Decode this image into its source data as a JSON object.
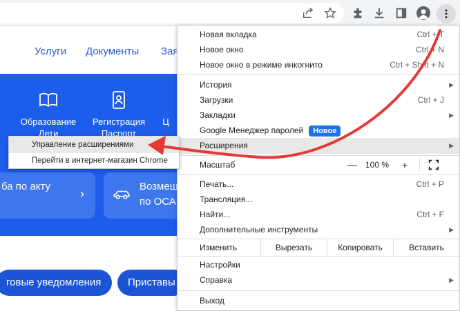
{
  "toolbar": {
    "icons": [
      "share-icon",
      "star-icon",
      "extensions-icon",
      "download-icon",
      "side-panel-icon",
      "profile-icon",
      "more-icon"
    ]
  },
  "site": {
    "nav": [
      "Услуги",
      "Документы",
      "Зая"
    ],
    "services": [
      {
        "icon": "book-icon",
        "label": "Образование Дети"
      },
      {
        "icon": "badge-icon",
        "label": "Регистрация Паспорт"
      },
      {
        "icon": "",
        "label": "Ц"
      }
    ],
    "card_left": "ба по акту",
    "card_right": "Возмещ по ОСА",
    "pill_left": "говые уведомления",
    "pill_right": "Приставы"
  },
  "menu": {
    "items": [
      {
        "label": "Новая вкладка",
        "shortcut": "Ctrl + T"
      },
      {
        "label": "Новое окно",
        "shortcut": "Ctrl + N"
      },
      {
        "label": "Новое окно в режиме инкогнито",
        "shortcut": "Ctrl + Shift + N"
      },
      {
        "label": "История",
        "arrow": "▶"
      },
      {
        "label": "Загрузки",
        "shortcut": "Ctrl + J"
      },
      {
        "label": "Закладки",
        "arrow": "▶"
      },
      {
        "label": "Google Менеджер паролей",
        "badge": "Новое"
      },
      {
        "label": "Расширения",
        "arrow": "▶"
      },
      {
        "label": "Печать...",
        "shortcut": "Ctrl + P"
      },
      {
        "label": "Трансляция..."
      },
      {
        "label": "Найти...",
        "shortcut": "Ctrl + F"
      },
      {
        "label": "Дополнительные инструменты",
        "arrow": "▶"
      },
      {
        "label": "Настройки"
      },
      {
        "label": "Справка",
        "arrow": "▶"
      },
      {
        "label": "Выход"
      }
    ],
    "zoom": {
      "label": "Масштаб",
      "minus": "—",
      "value": "100 %",
      "plus": "+"
    },
    "edit": {
      "label": "Изменить",
      "cut": "Вырезать",
      "copy": "Копировать",
      "paste": "Вставить"
    }
  },
  "submenu": {
    "items": [
      "Управление расширениями",
      "Перейти в интернет-магазин Chrome"
    ]
  },
  "colors": {
    "site_blue": "#1d5deb",
    "annotation_red": "#e53935",
    "badge_blue": "#1a73e8"
  }
}
